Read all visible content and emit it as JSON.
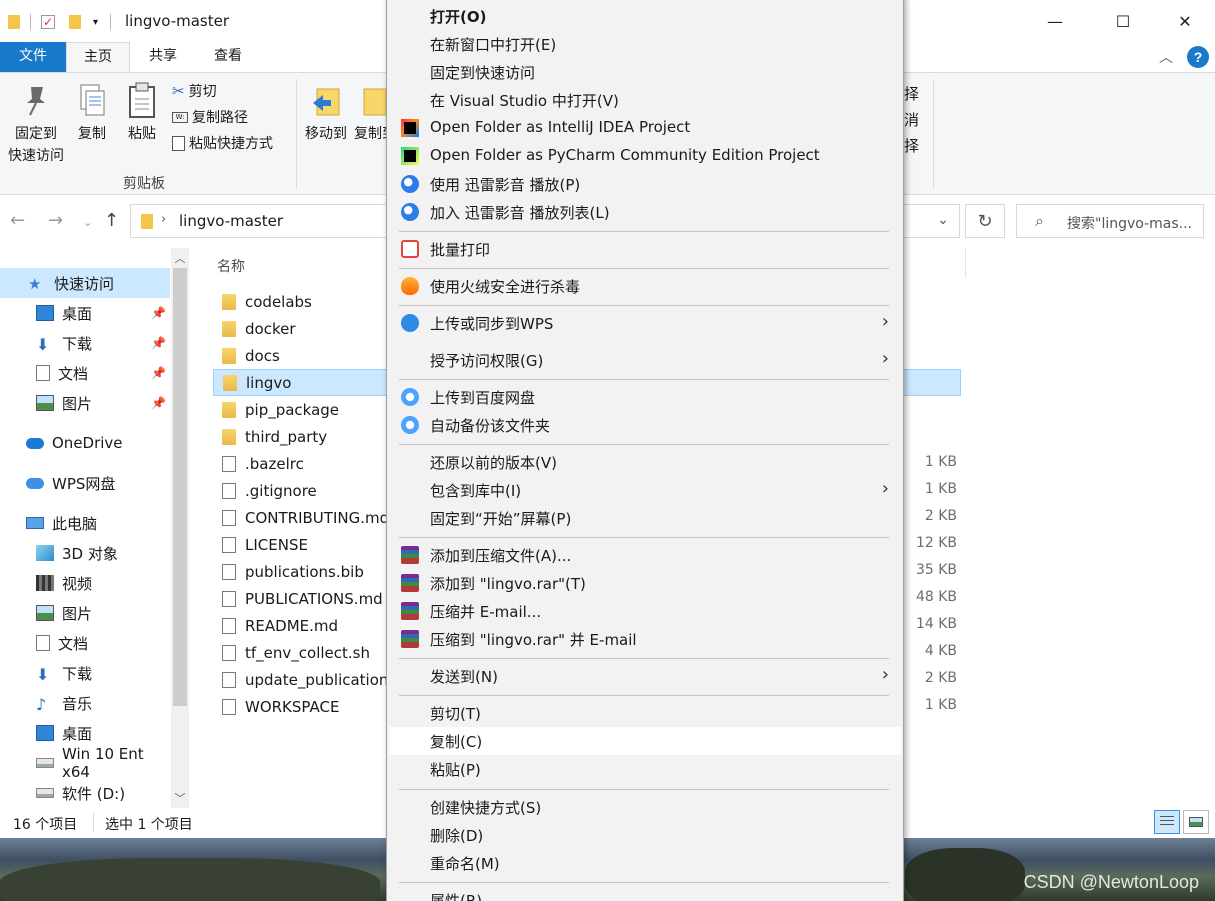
{
  "window": {
    "title": "lingvo-master",
    "minimize": "—",
    "maximize": "☐",
    "close": "✕"
  },
  "ribbon_tabs": {
    "file": "文件",
    "home": "主页",
    "share": "共享",
    "view": "查看"
  },
  "ribbon": {
    "pin_quick_line1": "固定到",
    "pin_quick_line2": "快速访问",
    "copy": "复制",
    "paste": "粘贴",
    "cut": "剪切",
    "copy_path": "复制路径",
    "paste_shortcut": "粘贴快捷方式",
    "clipboard_group": "剪贴板",
    "move_to": "移动到",
    "copy_to": "复制到",
    "right_partial_1": "择",
    "right_partial_2": "消",
    "right_partial_3": "择"
  },
  "address": {
    "path": "lingvo-master",
    "search_placeholder": "搜索\"lingvo-mas..."
  },
  "nav": [
    {
      "label": "快速访问",
      "icon": "star-icon",
      "selected": true
    },
    {
      "label": "桌面",
      "icon": "desktop-icon",
      "pinned": true
    },
    {
      "label": "下载",
      "icon": "download-icon",
      "pinned": true
    },
    {
      "label": "文档",
      "icon": "document-icon",
      "pinned": true
    },
    {
      "label": "图片",
      "icon": "picture-icon",
      "pinned": true
    },
    {
      "label": "OneDrive",
      "icon": "cloud-icon"
    },
    {
      "label": "WPS网盘",
      "icon": "wps-cloud-icon"
    },
    {
      "label": "此电脑",
      "icon": "computer-icon"
    },
    {
      "label": "3D 对象",
      "icon": "cube-icon"
    },
    {
      "label": "视频",
      "icon": "video-icon"
    },
    {
      "label": "图片",
      "icon": "picture-icon"
    },
    {
      "label": "文档",
      "icon": "document-icon"
    },
    {
      "label": "下载",
      "icon": "download-icon"
    },
    {
      "label": "音乐",
      "icon": "music-icon"
    },
    {
      "label": "桌面",
      "icon": "desktop-icon"
    },
    {
      "label": "Win 10 Ent x64",
      "icon": "drive-icon"
    },
    {
      "label": "软件 (D:)",
      "icon": "drive-icon"
    }
  ],
  "filelist": {
    "column_name": "名称",
    "rows": [
      {
        "name": "codelabs",
        "type": "folder",
        "size": ""
      },
      {
        "name": "docker",
        "type": "folder",
        "size": ""
      },
      {
        "name": "docs",
        "type": "folder",
        "size": ""
      },
      {
        "name": "lingvo",
        "type": "folder",
        "size": "",
        "selected": true
      },
      {
        "name": "pip_package",
        "type": "folder",
        "size": ""
      },
      {
        "name": "third_party",
        "type": "folder",
        "size": ""
      },
      {
        "name": ".bazelrc",
        "type": "file",
        "size": "1 KB"
      },
      {
        "name": ".gitignore",
        "type": "file",
        "size": "1 KB"
      },
      {
        "name": "CONTRIBUTING.md",
        "type": "file",
        "size": "2 KB"
      },
      {
        "name": "LICENSE",
        "type": "file",
        "size": "12 KB"
      },
      {
        "name": "publications.bib",
        "type": "file",
        "size": "35 KB"
      },
      {
        "name": "PUBLICATIONS.md",
        "type": "file",
        "size": "48 KB"
      },
      {
        "name": "README.md",
        "type": "file",
        "size": "14 KB"
      },
      {
        "name": "tf_env_collect.sh",
        "type": "file",
        "size": "4 KB"
      },
      {
        "name": "update_publication",
        "type": "file",
        "size": "2 KB"
      },
      {
        "name": "WORKSPACE",
        "type": "file",
        "size": "1 KB"
      }
    ]
  },
  "status": {
    "count": "16 个项目",
    "selected": "选中 1 个项目"
  },
  "context_menu": {
    "items": [
      {
        "label": "打开(O)",
        "bold": true
      },
      {
        "label": "在新窗口中打开(E)"
      },
      {
        "label": "固定到快速访问"
      },
      {
        "label": "在 Visual Studio 中打开(V)"
      },
      {
        "label": "Open Folder as IntelliJ IDEA Project",
        "icon": "intellij-icon"
      },
      {
        "label": "Open Folder as PyCharm Community Edition Project",
        "icon": "pycharm-icon"
      },
      {
        "label": "使用 迅雷影音 播放(P)",
        "icon": "xunlei-icon"
      },
      {
        "label": "加入 迅雷影音 播放列表(L)",
        "icon": "xunlei-icon"
      },
      {
        "label": "批量打印",
        "icon": "printer-icon"
      },
      {
        "label": "使用火绒安全进行杀毒",
        "icon": "huorong-icon"
      },
      {
        "label": "上传或同步到WPS",
        "icon": "wps-upload-icon",
        "submenu": true
      },
      {
        "label": "授予访问权限(G)",
        "submenu": true
      },
      {
        "label": "上传到百度网盘",
        "icon": "baidu-cloud-icon"
      },
      {
        "label": "自动备份该文件夹",
        "icon": "baidu-cloud-icon"
      },
      {
        "label": "还原以前的版本(V)"
      },
      {
        "label": "包含到库中(I)",
        "submenu": true
      },
      {
        "label": "固定到“开始”屏幕(P)"
      },
      {
        "label": "添加到压缩文件(A)...",
        "icon": "winrar-icon"
      },
      {
        "label": "添加到 \"lingvo.rar\"(T)",
        "icon": "winrar-icon"
      },
      {
        "label": "压缩并 E-mail...",
        "icon": "winrar-icon"
      },
      {
        "label": "压缩到 \"lingvo.rar\" 并 E-mail",
        "icon": "winrar-icon"
      },
      {
        "label": "发送到(N)",
        "submenu": true
      },
      {
        "label": "剪切(T)"
      },
      {
        "label": "复制(C)",
        "hover": true
      },
      {
        "label": "粘贴(P)"
      },
      {
        "label": "创建快捷方式(S)"
      },
      {
        "label": "删除(D)"
      },
      {
        "label": "重命名(M)"
      },
      {
        "label": "属性(R)"
      }
    ]
  },
  "watermark": "CSDN @NewtonLoop"
}
